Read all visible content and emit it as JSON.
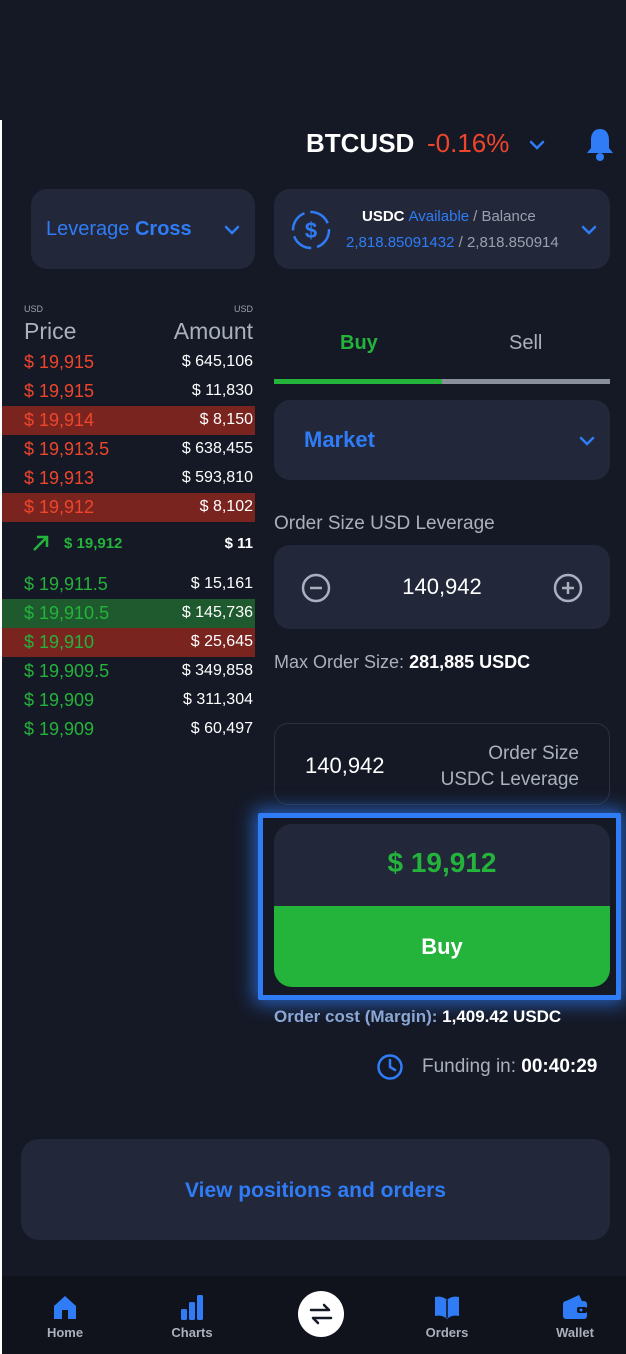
{
  "header": {
    "symbol": "BTCUSD",
    "change": "-0.16%"
  },
  "leverage": {
    "label": "Leverage",
    "value": "Cross"
  },
  "balance": {
    "token": "USDC",
    "available_label": "Available",
    "separator": "/ Balance",
    "available_value": "2,818.85091432",
    "balance_value": "/ 2,818.850914"
  },
  "orderbook": {
    "price_unit": "USD",
    "amount_unit": "USD",
    "price_header": "Price",
    "amount_header": "Amount",
    "asks": [
      {
        "price": "$ 19,915",
        "amount": "$ 645,106",
        "highlight": false
      },
      {
        "price": "$ 19,915",
        "amount": "$ 11,830",
        "highlight": false
      },
      {
        "price": "$ 19,914",
        "amount": "$ 8,150",
        "highlight": true
      },
      {
        "price": "$ 19,913.5",
        "amount": "$ 638,455",
        "highlight": false
      },
      {
        "price": "$ 19,913",
        "amount": "$ 593,810",
        "highlight": false
      },
      {
        "price": "$ 19,912",
        "amount": "$ 8,102",
        "highlight": true
      }
    ],
    "last": {
      "price": "$ 19,912",
      "amount": "$ 11"
    },
    "bids": [
      {
        "price": "$ 19,911.5",
        "amount": "$ 15,161",
        "highlight": "none"
      },
      {
        "price": "$ 19,910.5",
        "amount": "$ 145,736",
        "highlight": "green"
      },
      {
        "price": "$ 19,910",
        "amount": "$ 25,645",
        "highlight": "red"
      },
      {
        "price": "$ 19,909.5",
        "amount": "$ 349,858",
        "highlight": "none"
      },
      {
        "price": "$ 19,909",
        "amount": "$ 311,304",
        "highlight": "none"
      },
      {
        "price": "$ 19,909",
        "amount": "$ 60,497",
        "highlight": "none"
      }
    ]
  },
  "tabs": {
    "buy": "Buy",
    "sell": "Sell",
    "active": "buy"
  },
  "order_type": {
    "selected": "Market"
  },
  "order_size": {
    "label": "Order Size USD Leverage",
    "value": "140,942",
    "max_label": "Max Order Size:",
    "max_value": "281,885 USDC"
  },
  "conversion": {
    "value": "140,942",
    "label_line1": "Order Size",
    "label_line2": "USDC Leverage"
  },
  "buy_panel": {
    "price": "$ 19,912",
    "button": "Buy"
  },
  "order_cost": {
    "label": "Order cost (Margin):",
    "value": "1,409.42 USDC"
  },
  "funding": {
    "label": "Funding in:",
    "value": "00:40:29"
  },
  "view_positions": "View positions and orders",
  "nav": {
    "home": "Home",
    "charts": "Charts",
    "orders": "Orders",
    "wallet": "Wallet"
  },
  "colors": {
    "background": "#151926",
    "card": "#22283a",
    "accent_blue": "#2f7cf6",
    "buy_green": "#24b33b",
    "sell_red": "#f0452a"
  }
}
